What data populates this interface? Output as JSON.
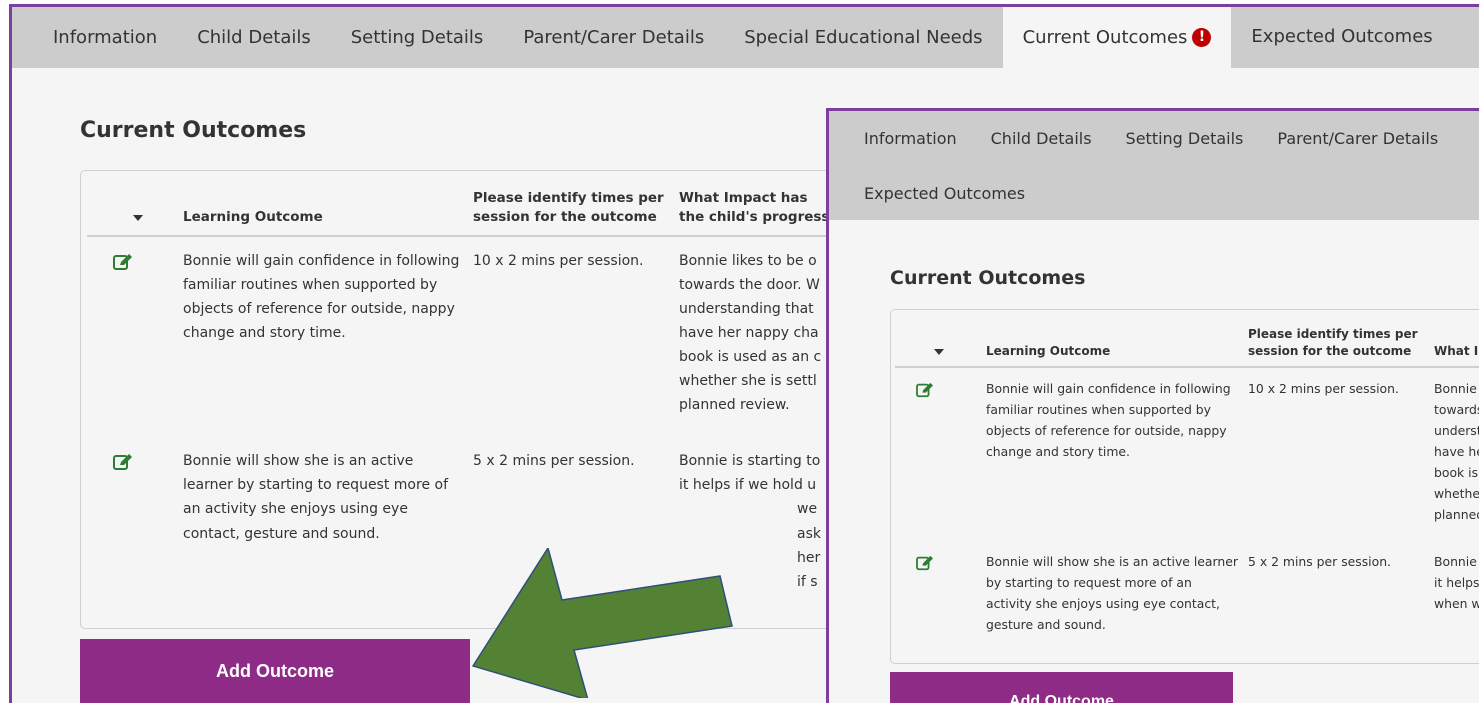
{
  "tabs": [
    "Information",
    "Child Details",
    "Setting Details",
    "Parent/Carer Details",
    "Special Educational Needs",
    "Current Outcomes"
  ],
  "tab_wrap": "Expected Outcomes",
  "active_tab": "Current Outcomes",
  "section_title": "Current Outcomes",
  "table": {
    "headers": [
      "Learning Outcome",
      "Please identify times per session for the outcome",
      "What Impact has the child's progress"
    ],
    "headers_inset": [
      "Learning Outcome",
      "Please identify times per session for the outcome",
      "What Imp the child"
    ],
    "rows": [
      {
        "outcome": "Bonnie will gain confidence in following familiar routines when supported by objects of reference for outside, nappy change and story time.",
        "times": "10 x 2 mins per session.",
        "impact_lines": [
          "Bonnie likes to be o",
          "towards the door. W",
          "understanding that",
          "have her nappy cha",
          "book is used as an c",
          "whether she is settl",
          "planned review."
        ],
        "impact_lines_inset": [
          "Bonnie li",
          "towards t",
          "understa",
          "have her",
          "book is u",
          "whether s",
          "planned r"
        ]
      },
      {
        "outcome": "Bonnie will show she is an active learner by starting to request more of an activity she enjoys using eye contact, gesture and sound.",
        "times": "5 x 2 mins per session.",
        "impact_lines": [
          "Bonnie is starting to",
          "it helps if we hold u",
          "we ask her if s"
        ],
        "impact_lines_inset": [
          "Bonnie is",
          "it helps if",
          "when we"
        ]
      }
    ]
  },
  "add_button": "Add Outcome",
  "colors": {
    "accent": "#8d2b87",
    "frame": "#7b3fa0",
    "arrow": "#548235",
    "alert": "#c00000"
  }
}
